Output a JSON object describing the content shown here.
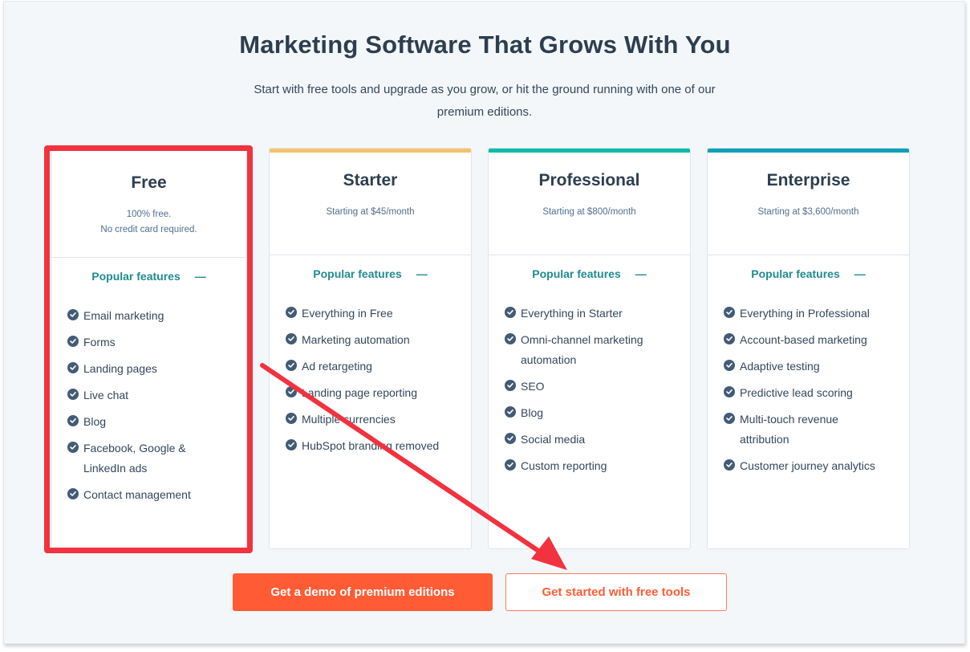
{
  "header": {
    "title": "Marketing Software That Grows With You",
    "subtitle_line1": "Start with free tools and upgrade as you grow, or hit the ground running with one of our",
    "subtitle_line2": "premium editions."
  },
  "plans": [
    {
      "name": "Free",
      "price_line1": "100% free.",
      "price_line2": "No credit card required.",
      "accent_color": "",
      "features_label": "Popular features",
      "collapse_icon": "minus-icon",
      "features": [
        "Email marketing",
        "Forms",
        "Landing pages",
        "Live chat",
        "Blog",
        "Facebook, Google & LinkedIn ads",
        "Contact management"
      ]
    },
    {
      "name": "Starter",
      "price_line1": "Starting at $45/month",
      "accent_color": "#f5c26b",
      "features_label": "Popular features",
      "collapse_icon": "minus-icon",
      "features": [
        "Everything in Free",
        "Marketing automation",
        "Ad retargeting",
        "Landing page reporting",
        "Multiple currencies",
        "HubSpot branding removed"
      ]
    },
    {
      "name": "Professional",
      "price_line1": "Starting at $800/month",
      "accent_color": "#00bda5",
      "features_label": "Popular features",
      "collapse_icon": "minus-icon",
      "features": [
        "Everything in Starter",
        "Omni-channel marketing automation",
        "SEO",
        "Blog",
        "Social media",
        "Custom reporting"
      ]
    },
    {
      "name": "Enterprise",
      "price_line1": "Starting at $3,600/month",
      "accent_color": "#0fa0b8",
      "features_label": "Popular features",
      "collapse_icon": "minus-icon",
      "features": [
        "Everything in Professional",
        "Account-based marketing",
        "Adaptive testing",
        "Predictive lead scoring",
        "Multi-touch revenue attribution",
        "Customer journey analytics"
      ]
    }
  ],
  "buttons": {
    "demo_label": "Get a demo of premium editions",
    "free_label": "Get started with free tools"
  },
  "annotations": {
    "highlight_target": "Free",
    "highlight_color": "#f2323f",
    "arrow_target": "Get started with free tools",
    "arrow_color": "#f2323f"
  },
  "colors": {
    "primary_orange": "#ff5c35",
    "teal": "#218b8f",
    "heading": "#2d3e50",
    "check": "#425b76",
    "background": "#f4f7fa"
  }
}
